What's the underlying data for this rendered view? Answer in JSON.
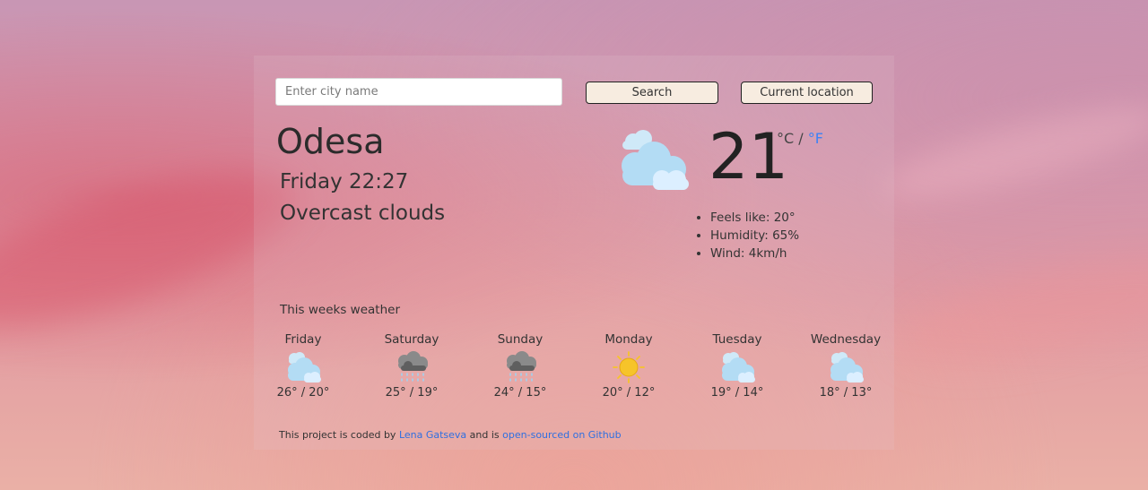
{
  "search": {
    "placeholder": "Enter city name",
    "search_label": "Search",
    "location_label": "Current location"
  },
  "current": {
    "city": "Odesa",
    "datetime": "Friday 22:27",
    "description": "Overcast clouds",
    "temperature": "21",
    "unit_c": "°C",
    "unit_separator": " / ",
    "unit_f": "°F",
    "icon": "cloudy-icon",
    "details": {
      "feels_like": "Feels like: 20°",
      "humidity": "Humidity: 65%",
      "wind": "Wind: 4km/h"
    }
  },
  "week": {
    "title": "This weeks weather",
    "days": [
      {
        "name": "Friday",
        "temps": "26° / 20°",
        "icon": "cloudy-icon"
      },
      {
        "name": "Saturday",
        "temps": "25° / 19°",
        "icon": "rain-cloud-icon"
      },
      {
        "name": "Sunday",
        "temps": "24° / 15°",
        "icon": "rain-cloud-icon"
      },
      {
        "name": "Monday",
        "temps": "20° / 12°",
        "icon": "sun-icon"
      },
      {
        "name": "Tuesday",
        "temps": "19° / 14°",
        "icon": "cloudy-icon"
      },
      {
        "name": "Wednesday",
        "temps": "18° / 13°",
        "icon": "cloudy-icon"
      }
    ]
  },
  "footer": {
    "prefix": "This project is coded by ",
    "author": "Lena Gatseva",
    "middle": " and is ",
    "repo_link": "open-sourced on Github"
  },
  "colors": {
    "link": "#2f6fe0",
    "unit_active": "#3b82f6",
    "button_bg": "#f7ece0",
    "cloud_light": "#bfe3f7",
    "cloud_dark": "#6b6b6b",
    "sun": "#f6c42a"
  }
}
